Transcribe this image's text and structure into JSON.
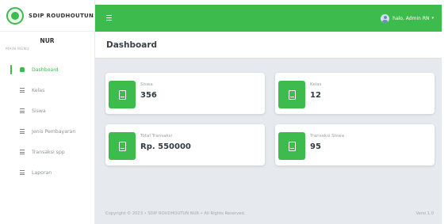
{
  "brand": {
    "name": "SDIP ROUDHOUTUN",
    "logo_icon": "school-logo-icon"
  },
  "sidebar": {
    "user_name": "NUR",
    "menu_heading": "MAIN MENU",
    "items": [
      {
        "label": "Dashboard",
        "icon": "home-icon",
        "active": true
      },
      {
        "label": "Kelas",
        "icon": "list-icon",
        "active": false
      },
      {
        "label": "Siswa",
        "icon": "list-icon",
        "active": false
      },
      {
        "label": "Jenis Pembayaran",
        "icon": "list-icon",
        "active": false
      },
      {
        "label": "Transaksi spp",
        "icon": "list-icon",
        "active": false
      },
      {
        "label": "Laporan",
        "icon": "list-icon",
        "active": false
      }
    ]
  },
  "topbar": {
    "menu_icon": "hamburger-icon",
    "user_label": "halo, Admin RN",
    "caret": "▾"
  },
  "main": {
    "title": "Dashboard",
    "cards": [
      {
        "label": "Siswa",
        "value": "356"
      },
      {
        "label": "Kelas",
        "value": "12"
      },
      {
        "label": "Total Transaksi",
        "value": "Rp. 550000"
      },
      {
        "label": "Transaksi Siswa",
        "value": "95"
      }
    ]
  },
  "footer": {
    "copyright": "Copyright © 2023  •  SDIP ROUDHOUTUN NUR  •  All Rights Reserved.",
    "version": "Versi 1.0"
  },
  "colors": {
    "accent": "#3dbb4d",
    "background": "#e6e9ed"
  }
}
